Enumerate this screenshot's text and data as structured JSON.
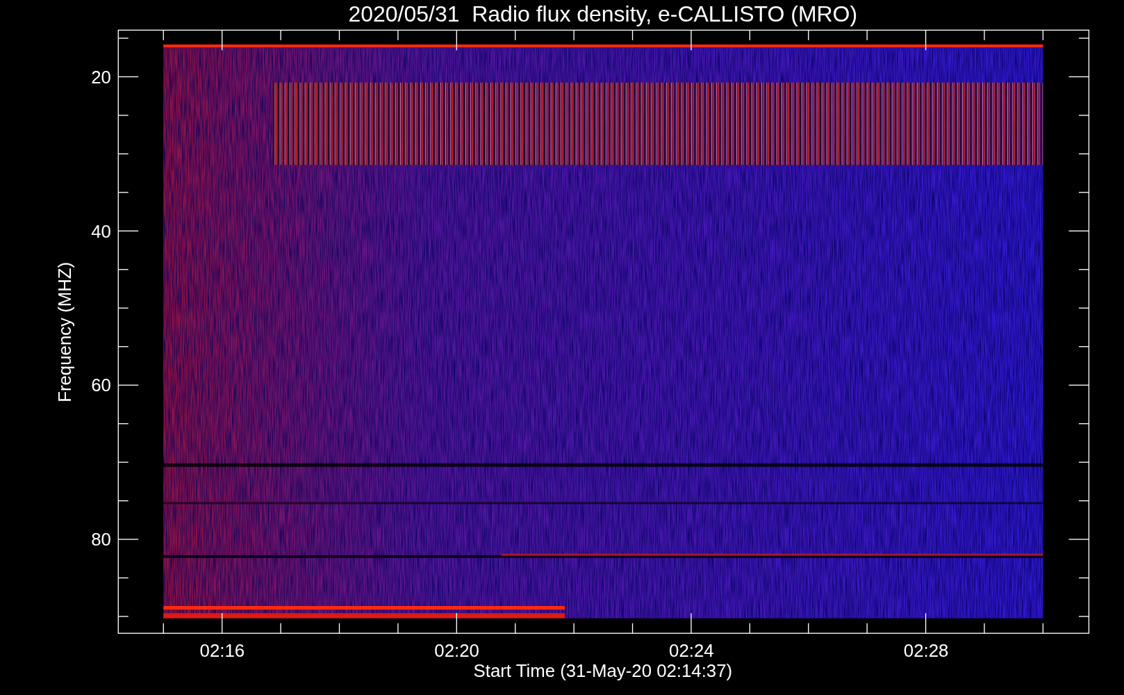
{
  "plot": {
    "title": "2020/05/31  Radio flux density, e-CALLISTO (MRO)",
    "ylabel": "Frequency (MHZ)",
    "xlabel": "Start Time (31-May-20 02:14:37)",
    "y_tick_labels": [
      "20",
      "40",
      "60",
      "80"
    ],
    "x_tick_labels": [
      "02:16",
      "02:20",
      "02:24",
      "02:28"
    ]
  }
}
